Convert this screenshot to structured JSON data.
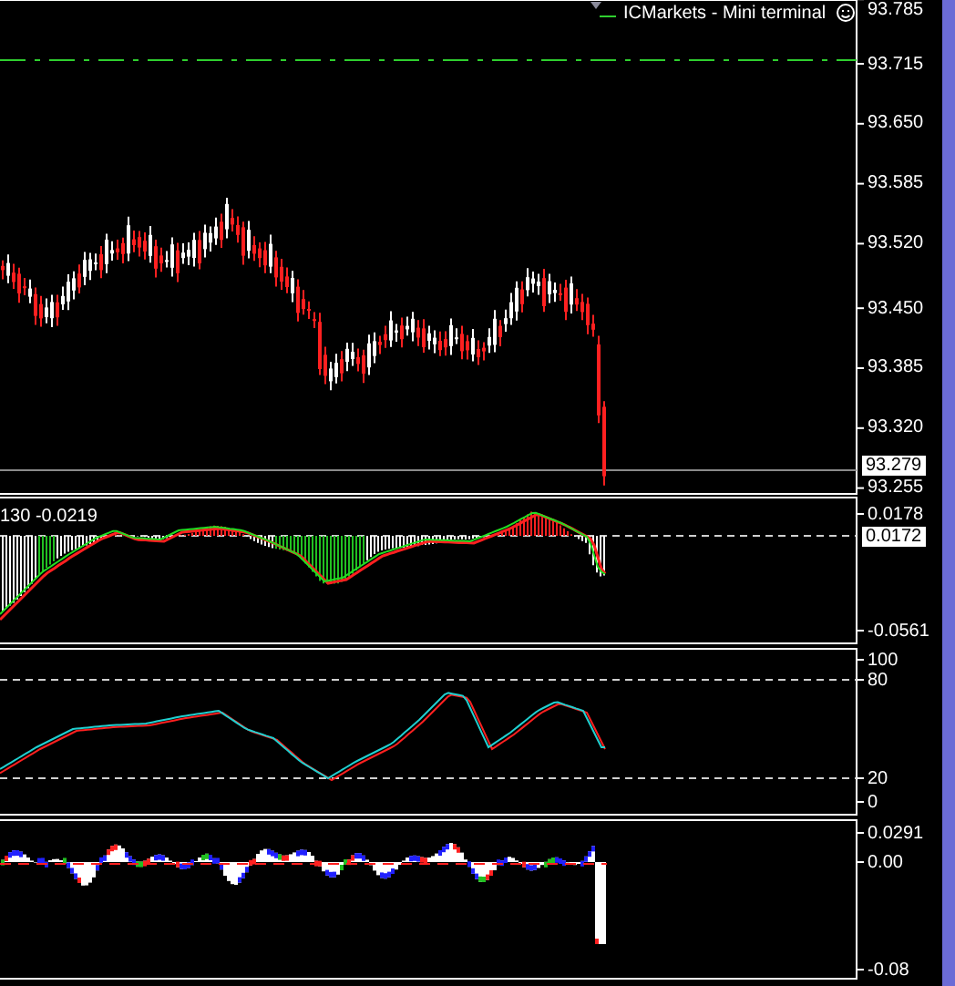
{
  "header": {
    "terminal_label": "ICMarkets - Mini terminal"
  },
  "panels": [
    {
      "kind": "price",
      "ticks": [
        {
          "label": "93.785",
          "kind": "tick"
        },
        {
          "label": "93.715",
          "kind": "tick"
        },
        {
          "label": "93.650",
          "kind": "tick"
        },
        {
          "label": "93.585",
          "kind": "tick"
        },
        {
          "label": "93.520",
          "kind": "tick"
        },
        {
          "label": "93.450",
          "kind": "tick"
        },
        {
          "label": "93.385",
          "kind": "tick"
        },
        {
          "label": "93.320",
          "kind": "tick"
        },
        {
          "label": "93.279",
          "kind": "current"
        },
        {
          "label": "93.255",
          "kind": "tick"
        }
      ]
    },
    {
      "kind": "macd",
      "indicator_label": "130 -0.0219",
      "ticks": [
        {
          "label": "0.0178",
          "kind": "tick"
        },
        {
          "label": "0.0172",
          "kind": "current"
        },
        {
          "label": "-0.0561",
          "kind": "tick"
        }
      ]
    },
    {
      "kind": "stochastic",
      "ticks": [
        {
          "label": "100",
          "kind": "tick"
        },
        {
          "label": "80",
          "kind": "tick"
        },
        {
          "label": "20",
          "kind": "tick"
        },
        {
          "label": "0",
          "kind": "tick"
        }
      ]
    },
    {
      "kind": "histogram",
      "ticks": [
        {
          "label": "0.0291",
          "kind": "tick"
        },
        {
          "label": "0.00",
          "kind": "tick"
        },
        {
          "label": "-0.08",
          "kind": "tick"
        }
      ]
    }
  ]
}
